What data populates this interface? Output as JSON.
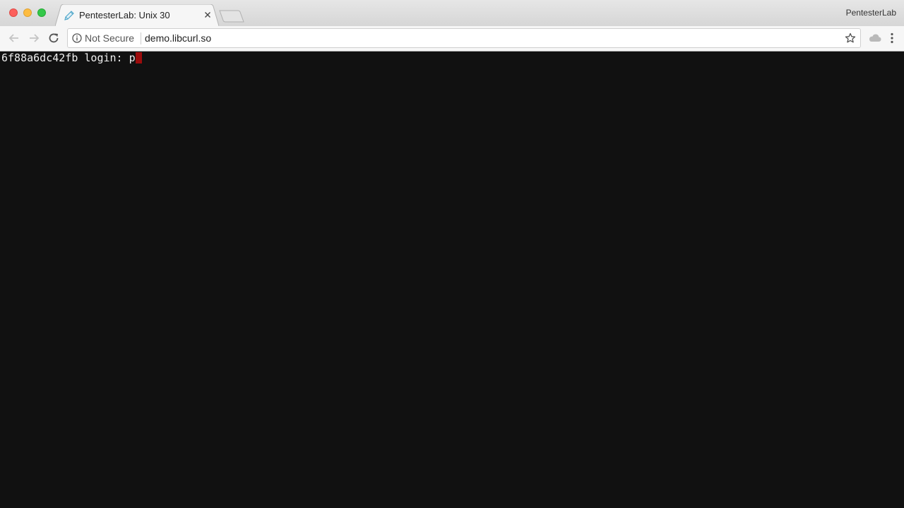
{
  "browser": {
    "profile_name": "PentesterLab",
    "tab": {
      "title": "PentesterLab: Unix 30",
      "favicon": "pencil-icon"
    },
    "toolbar": {
      "back": "back-arrow-icon",
      "forward": "forward-arrow-icon",
      "reload": "reload-icon",
      "extension": "cloud-icon",
      "menu": "kebab-menu-icon"
    },
    "omnibox": {
      "security_label": "Not Secure",
      "url": "demo.libcurl.so"
    }
  },
  "terminal": {
    "prompt": "6f88a6dc42fb login: ",
    "input": "p",
    "cursor_color": "#9b0c0c",
    "background": "#111111"
  }
}
